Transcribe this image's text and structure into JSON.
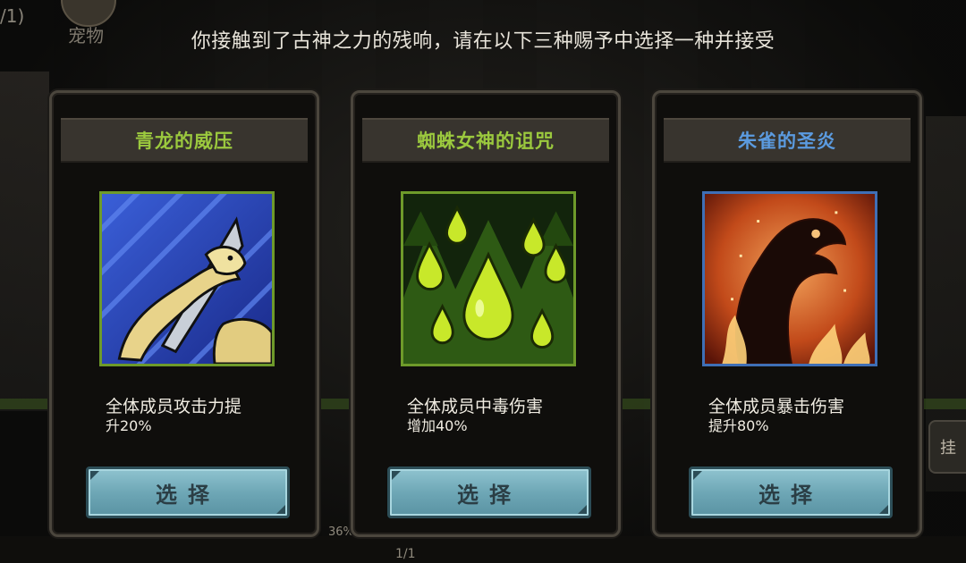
{
  "instruction": "你接触到了古神之力的残响，请在以下三种赐予中选择一种并接受",
  "background": {
    "top_left_text": "/1)",
    "pet_label": "宠物",
    "right_tab_label": "挂",
    "percent_text": "36%",
    "fraction_text": "1/1"
  },
  "cards": [
    {
      "title": "青龙的威压",
      "title_color": "#9bc93e",
      "icon": "azure-dragon-icon",
      "desc_line1": "全体成员攻击力提",
      "desc_line2": "升20%",
      "button_label": "选择"
    },
    {
      "title": "蜘蛛女神的诅咒",
      "title_color": "#9bc93e",
      "icon": "poison-drops-icon",
      "desc_line1": "全体成员中毒伤害",
      "desc_line2": "增加40%",
      "button_label": "选择"
    },
    {
      "title": "朱雀的圣炎",
      "title_color": "#5b9be0",
      "icon": "vermilion-bird-icon",
      "desc_line1": "全体成员暴击伤害",
      "desc_line2": "提升80%",
      "button_label": "选择"
    }
  ]
}
